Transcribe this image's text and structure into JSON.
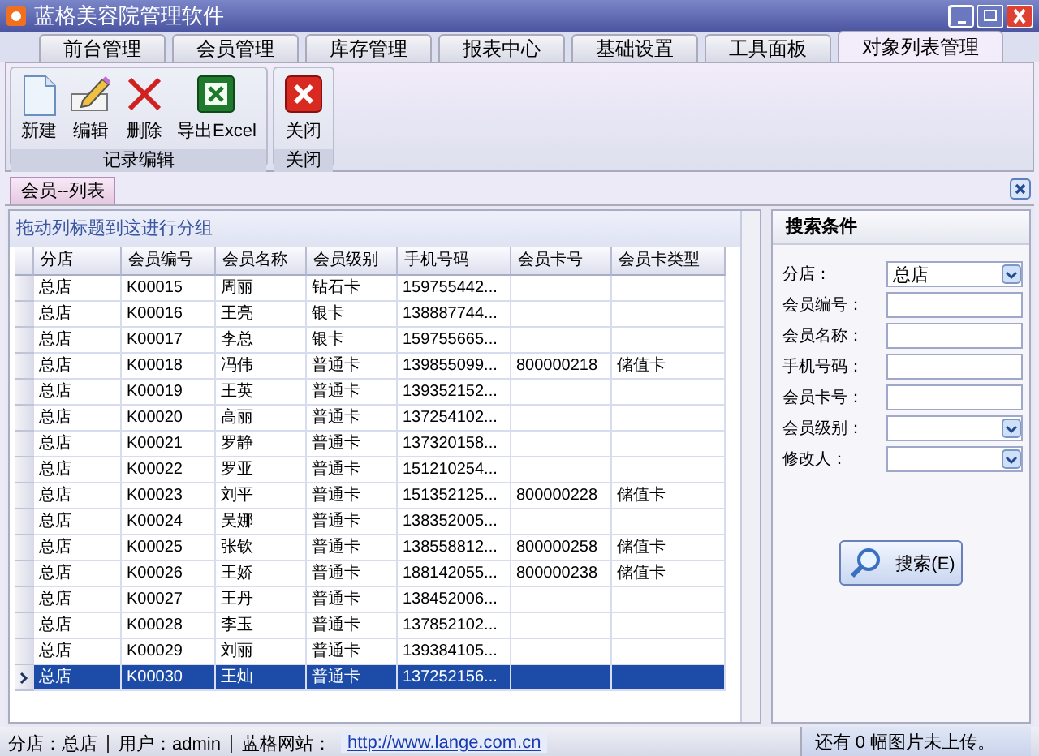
{
  "window": {
    "title": "蓝格美容院管理软件"
  },
  "menu_tabs": [
    {
      "label": "前台管理",
      "selected": false
    },
    {
      "label": "会员管理",
      "selected": false
    },
    {
      "label": "库存管理",
      "selected": false
    },
    {
      "label": "报表中心",
      "selected": false
    },
    {
      "label": "基础设置",
      "selected": false
    },
    {
      "label": "工具面板",
      "selected": false
    },
    {
      "label": "对象列表管理",
      "selected": true
    }
  ],
  "ribbon_groups": [
    {
      "label": "记录编辑",
      "buttons": [
        {
          "label": "新建",
          "kind": "new"
        },
        {
          "label": "编辑",
          "kind": "edit"
        },
        {
          "label": "删除",
          "kind": "delete"
        },
        {
          "label": "导出Excel",
          "kind": "excel"
        }
      ]
    },
    {
      "label": "关闭",
      "buttons": [
        {
          "label": "关闭",
          "kind": "close"
        }
      ]
    }
  ],
  "doc_tabs": [
    {
      "label": "会员--列表",
      "selected": true
    }
  ],
  "grid": {
    "group_hint": "拖动列标题到这进行分组",
    "columns": [
      "分店",
      "会员编号",
      "会员名称",
      "会员级别",
      "手机号码",
      "会员卡号",
      "会员卡类型"
    ],
    "rows": [
      {
        "cells": [
          "总店",
          "K00015",
          "周丽",
          "钻石卡",
          "159755442...",
          "",
          ""
        ],
        "selected": false
      },
      {
        "cells": [
          "总店",
          "K00016",
          "王亮",
          "银卡",
          "138887744...",
          "",
          ""
        ],
        "selected": false
      },
      {
        "cells": [
          "总店",
          "K00017",
          "李总",
          "银卡",
          "159755665...",
          "",
          ""
        ],
        "selected": false
      },
      {
        "cells": [
          "总店",
          "K00018",
          "冯伟",
          "普通卡",
          "139855099...",
          "800000218",
          "储值卡"
        ],
        "selected": false
      },
      {
        "cells": [
          "总店",
          "K00019",
          "王英",
          "普通卡",
          "139352152...",
          "",
          ""
        ],
        "selected": false
      },
      {
        "cells": [
          "总店",
          "K00020",
          "高丽",
          "普通卡",
          "137254102...",
          "",
          ""
        ],
        "selected": false
      },
      {
        "cells": [
          "总店",
          "K00021",
          "罗静",
          "普通卡",
          "137320158...",
          "",
          ""
        ],
        "selected": false
      },
      {
        "cells": [
          "总店",
          "K00022",
          "罗亚",
          "普通卡",
          "151210254...",
          "",
          ""
        ],
        "selected": false
      },
      {
        "cells": [
          "总店",
          "K00023",
          "刘平",
          "普通卡",
          "151352125...",
          "800000228",
          "储值卡"
        ],
        "selected": false
      },
      {
        "cells": [
          "总店",
          "K00024",
          "吴娜",
          "普通卡",
          "138352005...",
          "",
          ""
        ],
        "selected": false
      },
      {
        "cells": [
          "总店",
          "K00025",
          "张钦",
          "普通卡",
          "138558812...",
          "800000258",
          "储值卡"
        ],
        "selected": false
      },
      {
        "cells": [
          "总店",
          "K00026",
          "王娇",
          "普通卡",
          "188142055...",
          "800000238",
          "储值卡"
        ],
        "selected": false
      },
      {
        "cells": [
          "总店",
          "K00027",
          "王丹",
          "普通卡",
          "138452006...",
          "",
          ""
        ],
        "selected": false
      },
      {
        "cells": [
          "总店",
          "K00028",
          "李玉",
          "普通卡",
          "137852102...",
          "",
          ""
        ],
        "selected": false
      },
      {
        "cells": [
          "总店",
          "K00029",
          "刘丽",
          "普通卡",
          "139384105...",
          "",
          ""
        ],
        "selected": false
      },
      {
        "cells": [
          "总店",
          "K00030",
          "王灿",
          "普通卡",
          "137252156...",
          "",
          ""
        ],
        "selected": true
      }
    ]
  },
  "search": {
    "title": "搜索条件",
    "fields": [
      {
        "label": "分店：",
        "kind": "dropdown",
        "value": "总店"
      },
      {
        "label": "会员编号：",
        "kind": "text"
      },
      {
        "label": "会员名称：",
        "kind": "text"
      },
      {
        "label": "手机号码：",
        "kind": "text"
      },
      {
        "label": "会员卡号：",
        "kind": "text"
      },
      {
        "label": "会员级别：",
        "kind": "dropdown"
      },
      {
        "label": "修改人：",
        "kind": "dropdown"
      }
    ],
    "button": "搜索(E)"
  },
  "status_bar": {
    "items": [
      "分店：总店",
      "用户：admin",
      "蓝格网站："
    ],
    "link": "http://www.lange.com.cn",
    "notice": "还有 0 幅图片未上传。"
  }
}
